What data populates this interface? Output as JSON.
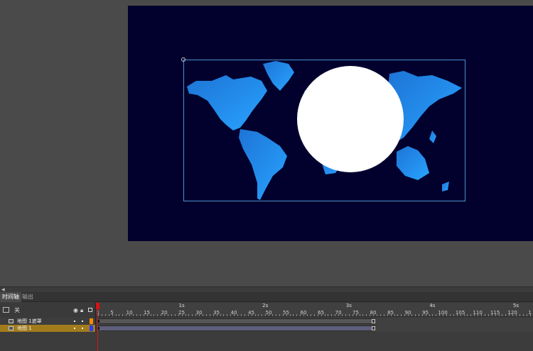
{
  "panel": {
    "tabs": [
      {
        "label": "时间轴"
      },
      {
        "label": "输出"
      }
    ],
    "header_label": "关"
  },
  "ruler": {
    "seconds": [
      "1s",
      "2s",
      "3s",
      "4s",
      "5s"
    ],
    "frames": [
      "1",
      "5",
      "10",
      "15",
      "20",
      "25",
      "30",
      "35",
      "40",
      "45",
      "50",
      "55",
      "60",
      "65",
      "70",
      "75",
      "80",
      "85",
      "90",
      "95",
      "100",
      "105",
      "110",
      "115",
      "120",
      "1"
    ]
  },
  "layers": [
    {
      "name": "地图 1遮罩",
      "color": "#ff8a00",
      "selected": false
    },
    {
      "name": "地图 1",
      "color": "#2a3cff",
      "selected": true
    }
  ],
  "icons": [
    "layer-folder-icon",
    "eye-icon",
    "lock-icon",
    "outline-icon",
    "layer-icon",
    "transform-point-icon"
  ],
  "colors": {
    "stage": "#02012e",
    "map": "#1f8de8",
    "mask": "#ffffff",
    "selected_layer": "#a27c1c",
    "playhead": "#dd1111"
  }
}
